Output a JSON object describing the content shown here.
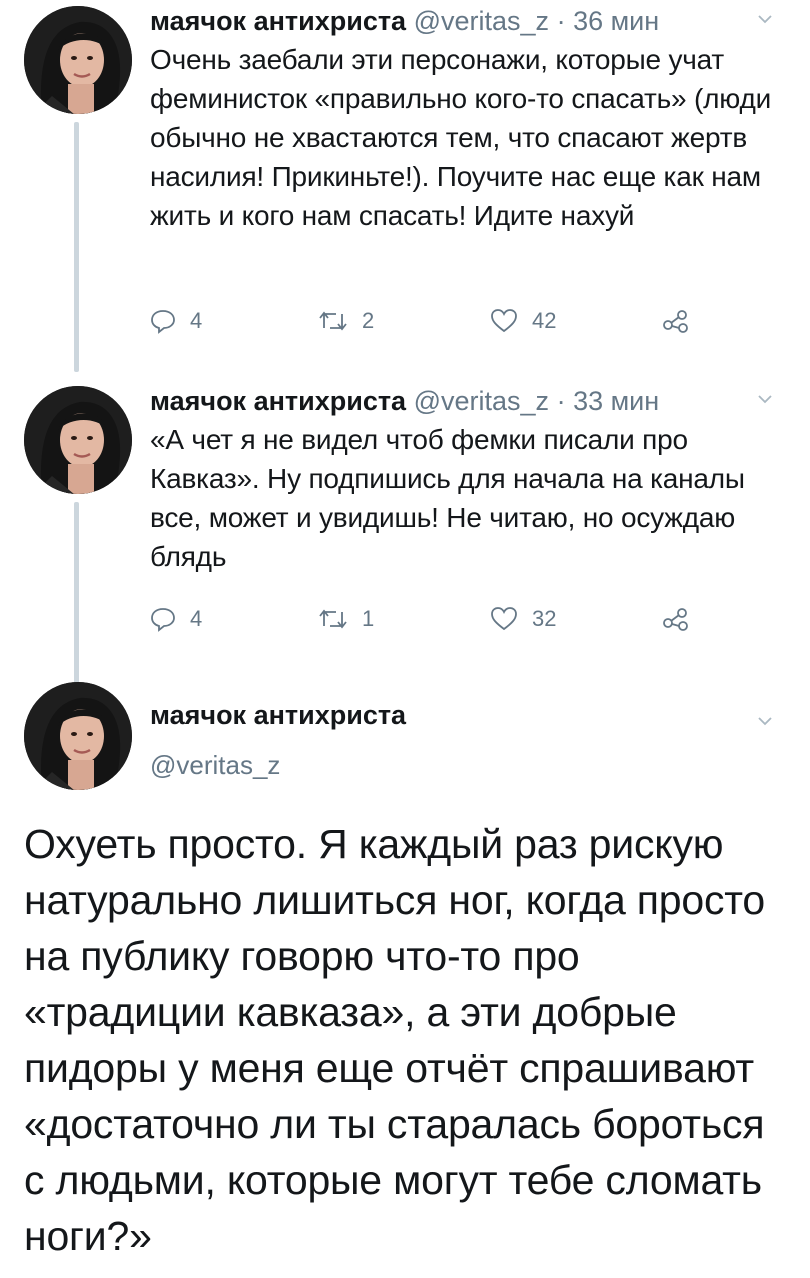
{
  "tweets": [
    {
      "name": "маячок антихриста",
      "handle": "@veritas_z",
      "time": "36 мин",
      "text": "Очень заебали эти персонажи, которые учат феминисток «правильно кого-то спасать» (люди обычно не хвастаются тем, что спасают жертв насилия! Прикиньте!). Поучите нас еще как нам жить и кого нам спасать! Идите нахуй",
      "replies": "4",
      "retweets": "2",
      "likes": "42"
    },
    {
      "name": "маячок антихриста",
      "handle": "@veritas_z",
      "time": "33 мин",
      "text": "«А чет я не видел чтоб фемки писали про Кавказ». Ну подпишись для начала на каналы все, может и увидишь! Не читаю, но осуждаю блядь",
      "replies": "4",
      "retweets": "1",
      "likes": "32"
    }
  ],
  "main_tweet": {
    "name": "маячок антихриста",
    "handle": "@veritas_z",
    "text": "Охуеть просто. Я каждый раз рискую натурально лишиться ног, когда просто на публику говорю что-то про «традиции кавказа», а эти добрые пидоры у меня еще отчёт спрашивают «достаточно ли ты старалась бороться с людьми, которые могут тебе сломать ноги?»"
  },
  "separator": "·",
  "icons": {
    "reply": "reply-icon",
    "retweet": "retweet-icon",
    "like": "heart-icon",
    "share": "share-icon",
    "caret": "chevron-down-icon"
  },
  "colors": {
    "text": "#14171a",
    "secondary": "#657786",
    "thread_line": "#ccd6dd"
  }
}
